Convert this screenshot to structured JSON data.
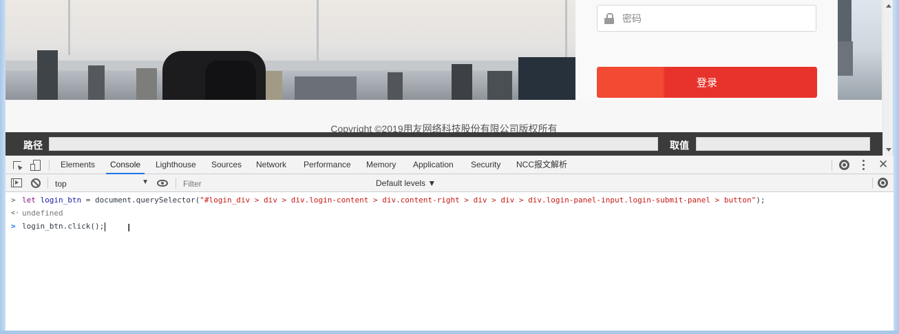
{
  "page": {
    "password_placeholder": "密码",
    "login_button": "登录",
    "copyright": "Copyright ©2019用友网络科技股份有限公司版权所有",
    "path_label": "路径",
    "value_label": "取值",
    "path_value": "",
    "value_value": ""
  },
  "devtools": {
    "tabs": [
      "Elements",
      "Console",
      "Lighthouse",
      "Sources",
      "Network",
      "Performance",
      "Memory",
      "Application",
      "Security",
      "NCC报文解析"
    ],
    "active_tab": "Console",
    "context": "top",
    "filter_placeholder": "Filter",
    "levels": "Default levels ▼"
  },
  "console": {
    "line1": {
      "prompt": ">",
      "kw": "let",
      "var": "login_btn",
      "mid": " = document.querySelector(",
      "str": "\"#login_div > div > div.login-content > div.content-right > div > div > div.login-panel-input.login-submit-panel > button\"",
      "end": ");"
    },
    "line2": {
      "prompt": "<·",
      "text": "undefined"
    },
    "line3": {
      "prompt": ">",
      "text": "login_btn.click();"
    }
  },
  "colors": {
    "login_button": "#e8332c",
    "devtools_active_tab": "#1a73e8",
    "string_literal": "#c41a16",
    "keyword": "#881280"
  }
}
